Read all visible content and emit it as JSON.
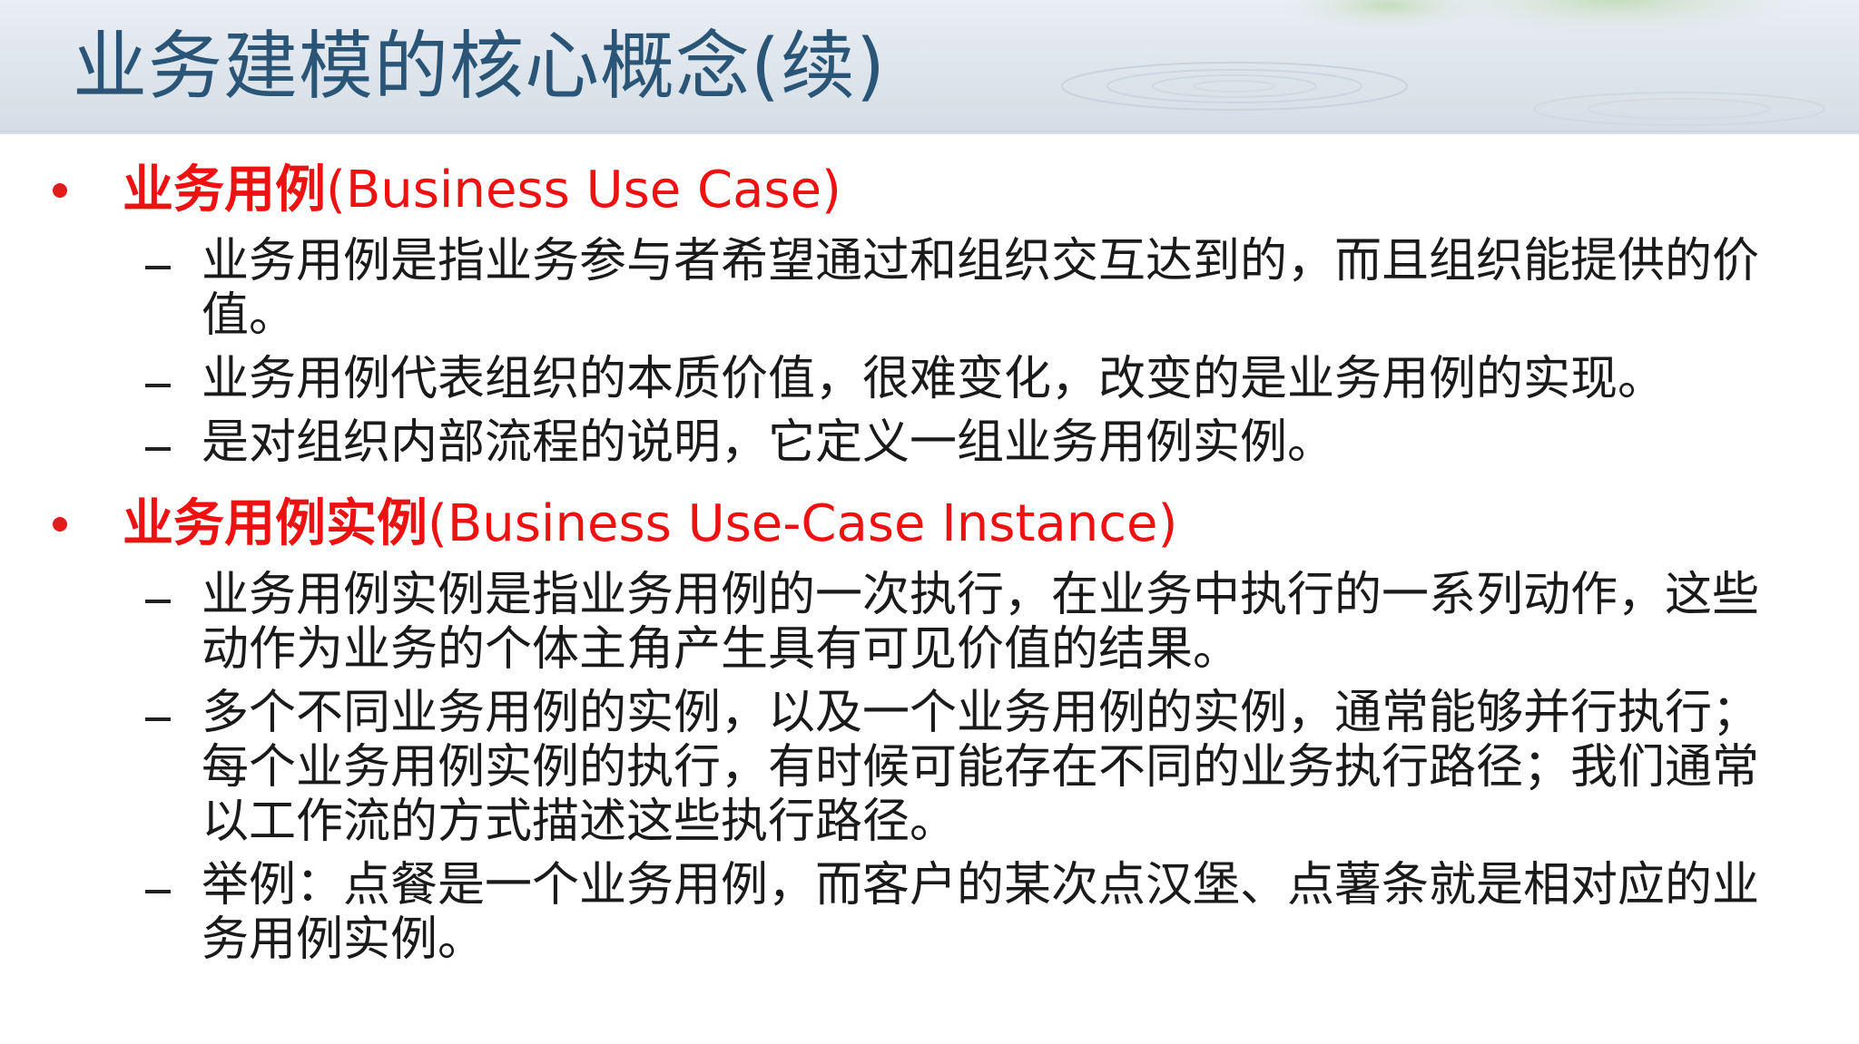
{
  "slide": {
    "title": "业务建模的核心概念(续)",
    "sections": [
      {
        "heading_cn": "业务用例",
        "heading_en": "(Business Use Case)",
        "items": [
          "业务用例是指业务参与者希望通过和组织交互达到的，而且组织能提供的价值。",
          "业务用例代表组织的本质价值，很难变化，改变的是业务用例的实现。",
          "是对组织内部流程的说明，它定义一组业务用例实例。"
        ]
      },
      {
        "heading_cn": "业务用例实例",
        "heading_en": "(Business Use-Case Instance)",
        "items": [
          "业务用例实例是指业务用例的一次执行，在业务中执行的一系列动作，这些动作为业务的个体主角产生具有可见价值的结果。",
          "多个不同业务用例的实例，以及一个业务用例的实例，通常能够并行执行；每个业务用例实例的执行，有时候可能存在不同的业务执行路径；我们通常以工作流的方式描述这些执行路径。",
          "举例：点餐是一个业务用例，而客户的某次点汉堡、点薯条就是相对应的业务用例实例。"
        ]
      }
    ]
  },
  "colors": {
    "title": "#2b5577",
    "heading": "#ee1111",
    "body": "#1a1a1a"
  }
}
